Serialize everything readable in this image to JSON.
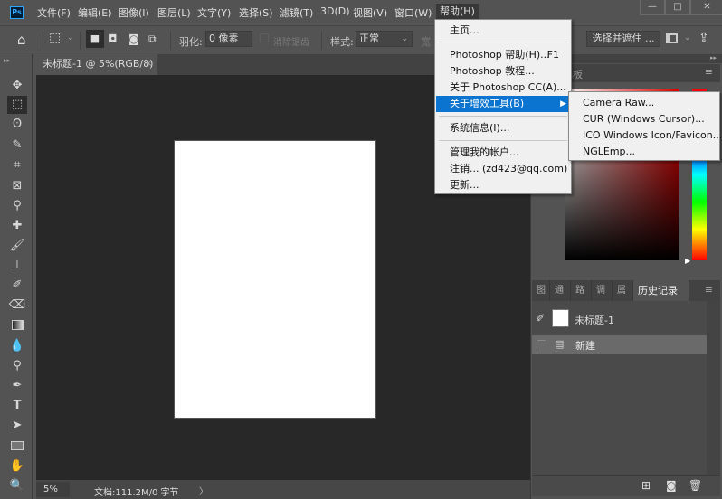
{
  "app": {
    "logo": "Ps",
    "accent": "#31a8ff"
  },
  "menubar": {
    "items": [
      {
        "label": "文件(F)"
      },
      {
        "label": "编辑(E)"
      },
      {
        "label": "图像(I)"
      },
      {
        "label": "图层(L)"
      },
      {
        "label": "文字(Y)"
      },
      {
        "label": "选择(S)"
      },
      {
        "label": "滤镜(T)"
      },
      {
        "label": "3D(D)"
      },
      {
        "label": "视图(V)"
      },
      {
        "label": "窗口(W)"
      },
      {
        "label": "帮助(H)"
      }
    ],
    "window_controls": {
      "minimize": "—",
      "maximize": "□",
      "close": "✕"
    }
  },
  "options_bar": {
    "feather_label": "羽化:",
    "feather_value": "0 像素",
    "antialias_label": "消除锯齿",
    "style_label": "样式:",
    "style_value": "正常",
    "width_label": "宽",
    "select_mask_button": "选择并遮住 ..."
  },
  "document_tab": {
    "title": "未标题-1 @ 5%(RGB/8)",
    "close": "×"
  },
  "status_bar": {
    "zoom": "5%",
    "doc_info": "文档:111.2M/0 字节",
    "arrow": "〉"
  },
  "help_menu": {
    "items": [
      {
        "label": "主页..."
      },
      {
        "label": "Photoshop 帮助(H)...",
        "shortcut": "F1"
      },
      {
        "label": "Photoshop 教程..."
      },
      {
        "label": "关于 Photoshop CC(A)..."
      },
      {
        "label": "关于增效工具(B)",
        "submenu": true,
        "highlighted": true
      },
      {
        "label": "系统信息(I)..."
      },
      {
        "label": "管理我的帐户..."
      },
      {
        "label": "注销... (zd423@qq.com)"
      },
      {
        "label": "更新..."
      }
    ],
    "highlight_color": "#0a74d0"
  },
  "plugins_submenu": {
    "items": [
      {
        "label": "Camera Raw..."
      },
      {
        "label": "CUR (Windows Cursor)..."
      },
      {
        "label": "ICO Windows Icon/Favicon..."
      },
      {
        "label": "NGLEmp..."
      }
    ]
  },
  "color_panel": {
    "tab_label": "色板",
    "foreground_color": "#e00000"
  },
  "history_panel": {
    "tabs": [
      {
        "label": "图层"
      },
      {
        "label": "通道"
      },
      {
        "label": "路径"
      },
      {
        "label": "调整"
      },
      {
        "label": "属性"
      },
      {
        "label": "历史记录",
        "active": true
      }
    ],
    "snapshot": {
      "label": "未标题-1"
    },
    "states": [
      {
        "label": "新建"
      }
    ]
  }
}
